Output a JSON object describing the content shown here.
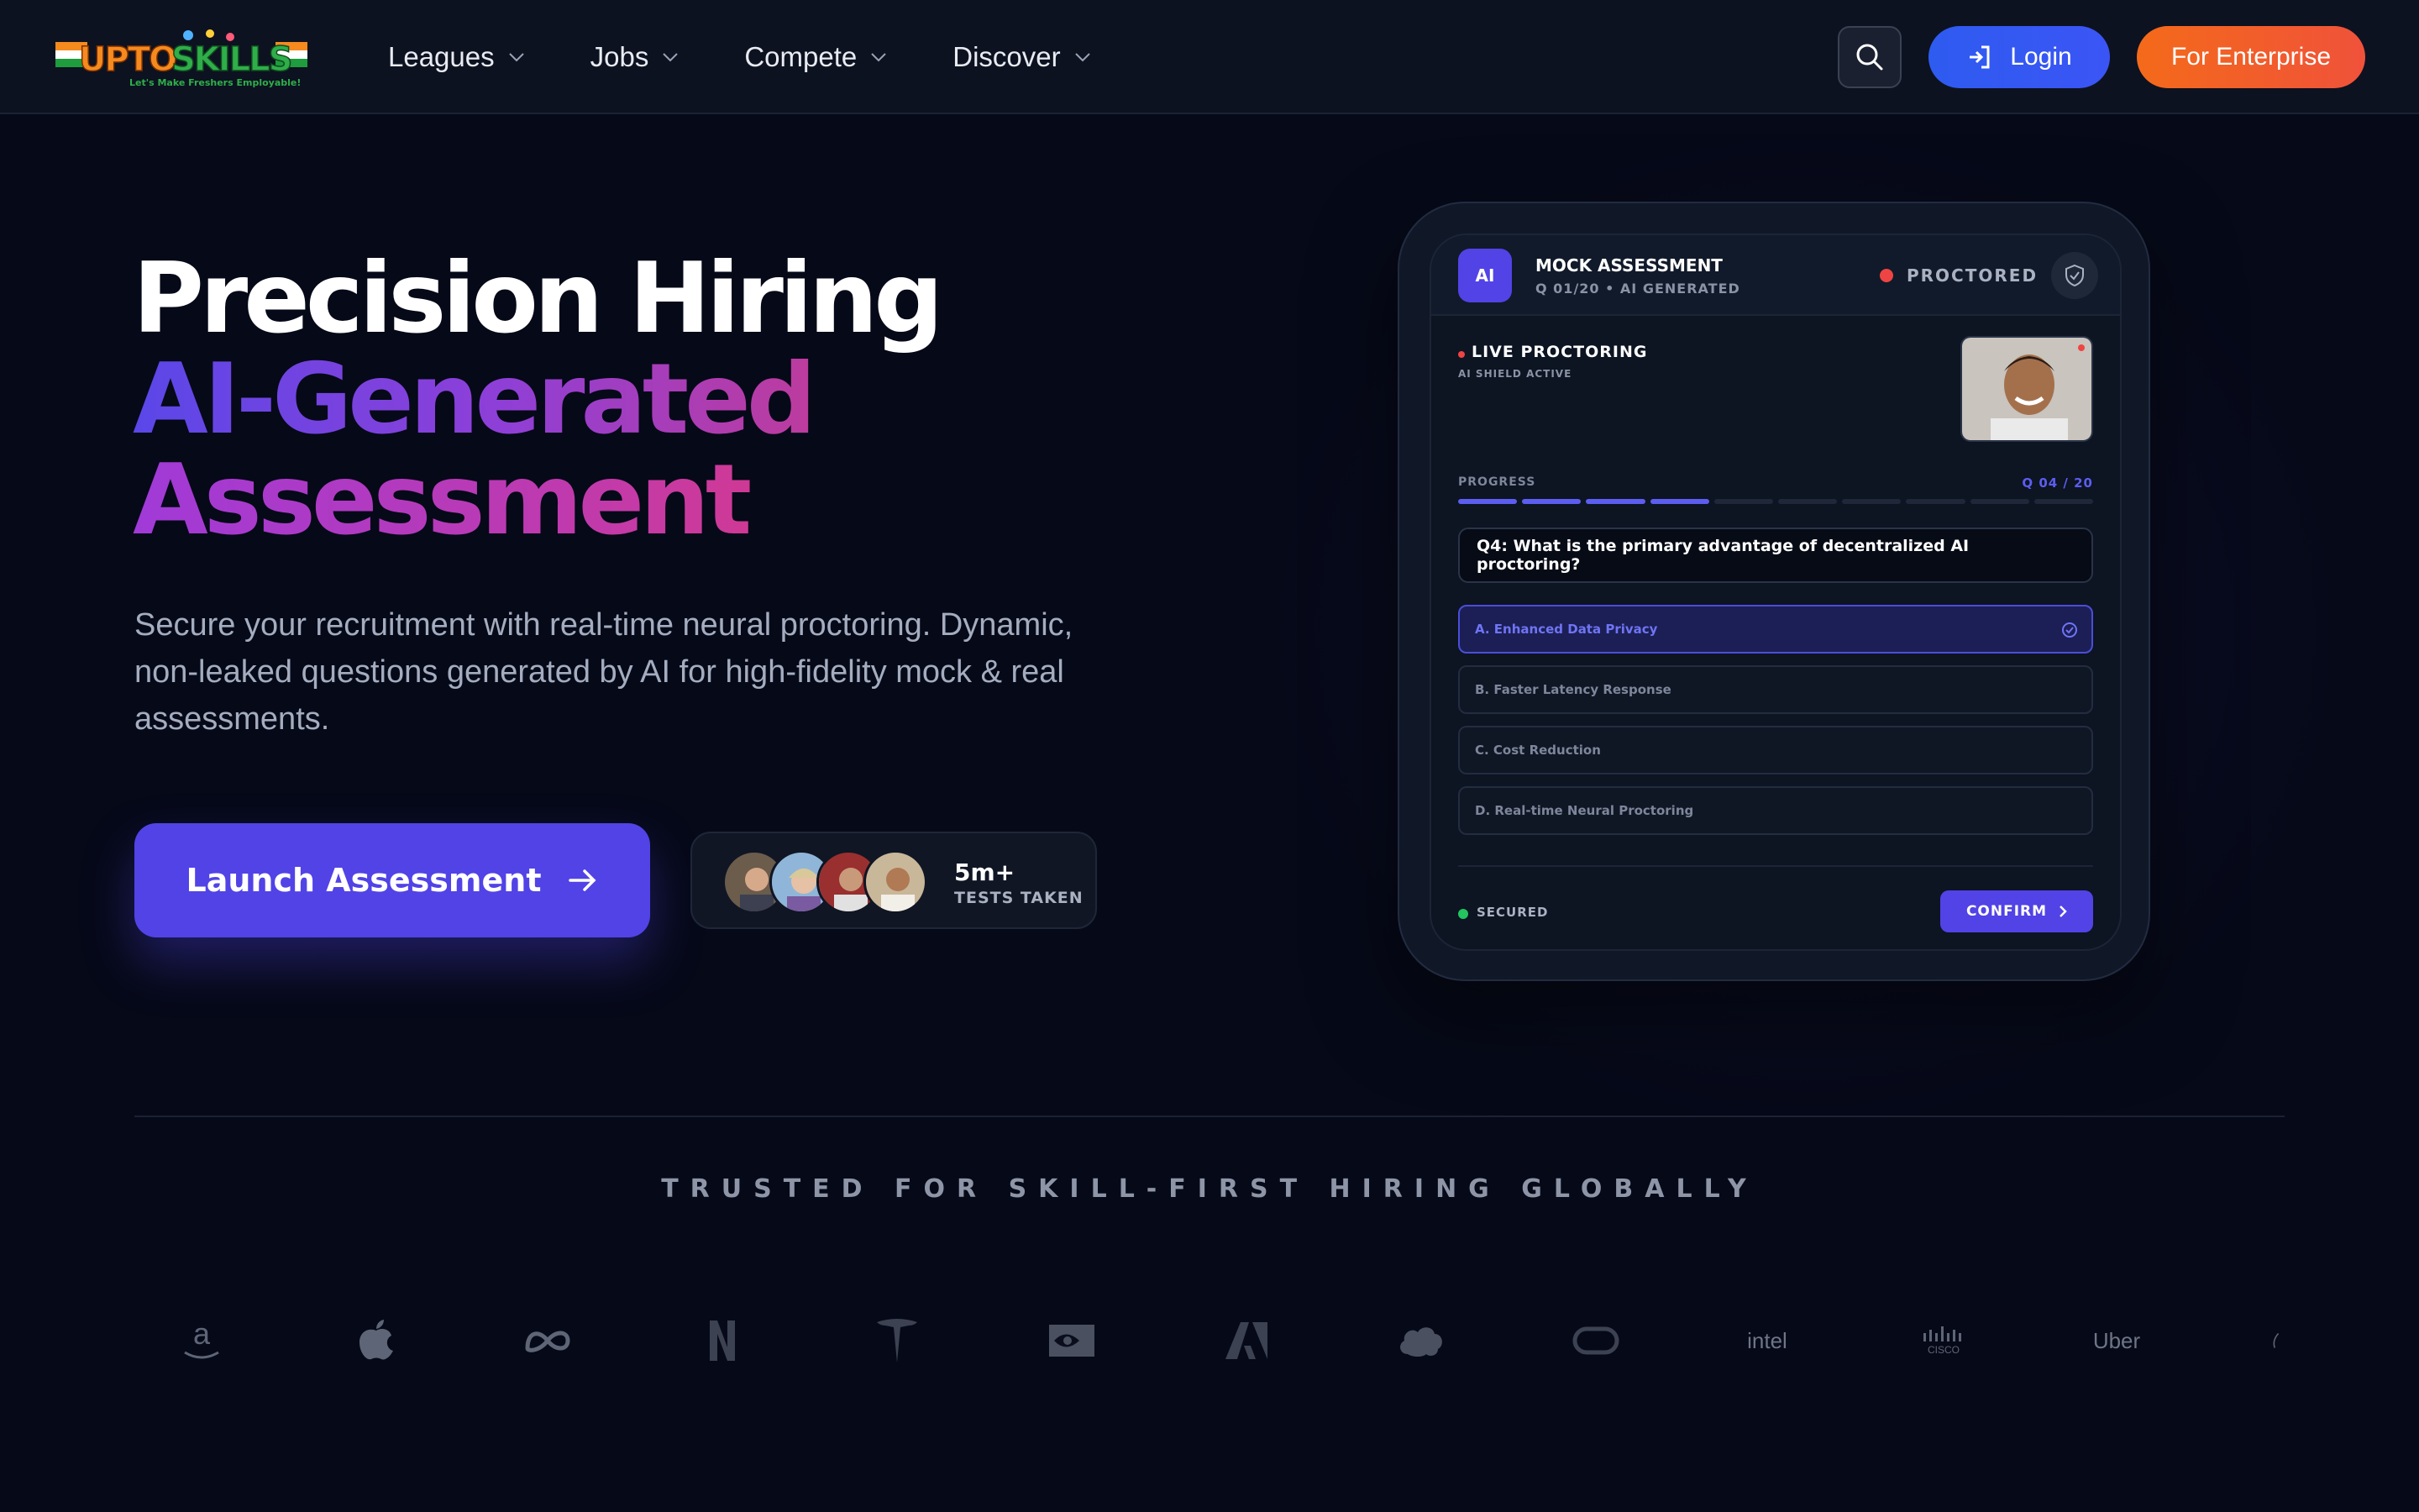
{
  "nav": {
    "logo_text": "UPTOSKILLS",
    "logo_tagline": "Let's Make Freshers Employable!",
    "items": [
      {
        "label": "Leagues"
      },
      {
        "label": "Jobs"
      },
      {
        "label": "Compete"
      },
      {
        "label": "Discover"
      }
    ],
    "login_label": "Login",
    "enterprise_label": "For Enterprise"
  },
  "hero": {
    "title_line1": "Precision Hiring",
    "title_line2": "AI-Generated",
    "title_line3": "Assessment",
    "subtitle": "Secure your recruitment with real-time neural proctoring. Dynamic, non-leaked questions generated by AI for high-fidelity mock & real assessments.",
    "cta_label": "Launch Assessment",
    "tests_count": "5m+",
    "tests_label": "TESTS TAKEN"
  },
  "mock": {
    "badge": "AI",
    "title": "MOCK ASSESSMENT",
    "subtitle": "Q 01/20 • AI GENERATED",
    "status": "PROCTORED",
    "live_title": "LIVE PROCTORING",
    "live_sub": "AI SHIELD ACTIVE",
    "progress_label": "PROGRESS",
    "progress_count": "Q 04 / 20",
    "progress_current": 4,
    "progress_total_segments": 10,
    "progress_filled_segments": 4,
    "question": "Q4: What is the primary advantage of decentralized AI proctoring?",
    "options": [
      {
        "label": "A. Enhanced Data Privacy",
        "selected": true
      },
      {
        "label": "B. Faster Latency Response",
        "selected": false
      },
      {
        "label": "C. Cost Reduction",
        "selected": false
      },
      {
        "label": "D. Real-time Neural Proctoring",
        "selected": false
      }
    ],
    "secured_label": "SECURED",
    "confirm_label": "CONFIRM"
  },
  "trusted": {
    "heading": "TRUSTED FOR SKILL-FIRST HIRING GLOBALLY",
    "brands": [
      "amazon-logo",
      "apple-logo",
      "meta-logo",
      "netflix-logo",
      "tesla-logo",
      "nvidia-logo",
      "adobe-logo",
      "salesforce-logo",
      "oracle-logo",
      "intel",
      "cisco-logo",
      "Uber",
      "partial-logo"
    ],
    "intel_text": "intel",
    "cisco_text": "CISCO",
    "uber_text": "Uber"
  },
  "colors": {
    "background": "#060918",
    "accent": "#5143e6",
    "login": "#2e5bf0",
    "enterprise": "#f46a1a",
    "danger": "#ef4444",
    "success": "#22c55e"
  }
}
